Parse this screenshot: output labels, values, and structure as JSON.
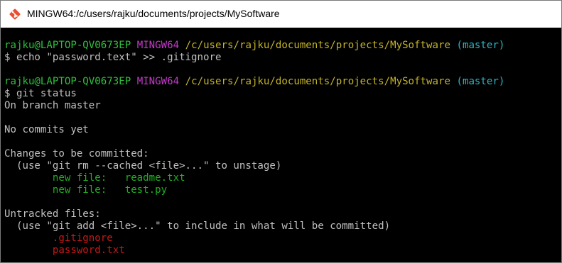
{
  "window": {
    "title": "MINGW64:/c/users/rajku/documents/projects/MySoftware"
  },
  "colors": {
    "user": "#2ec03b",
    "system": "#c23bc8",
    "path": "#c4b32b",
    "branch": "#2eb4c6",
    "staged": "#20b020",
    "untracked": "#c81818"
  },
  "prompt": {
    "user_host": "rajku@LAPTOP-QV0673EP",
    "system": "MINGW64",
    "path": "/c/users/rajku/documents/projects/MySoftware",
    "branch": "(master)"
  },
  "commands": {
    "first": "$ echo \"password.text\" >> .gitignore",
    "second": "$ git status"
  },
  "status": {
    "on_branch": "On branch master",
    "no_commits": "No commits yet",
    "staged_header": "Changes to be committed:",
    "staged_hint": "  (use \"git rm --cached <file>...\" to unstage)",
    "staged_files": [
      "        new file:   readme.txt",
      "        new file:   test.py"
    ],
    "untracked_header": "Untracked files:",
    "untracked_hint": "  (use \"git add <file>...\" to include in what will be committed)",
    "untracked_files": [
      "        .gitignore",
      "        password.txt"
    ]
  }
}
